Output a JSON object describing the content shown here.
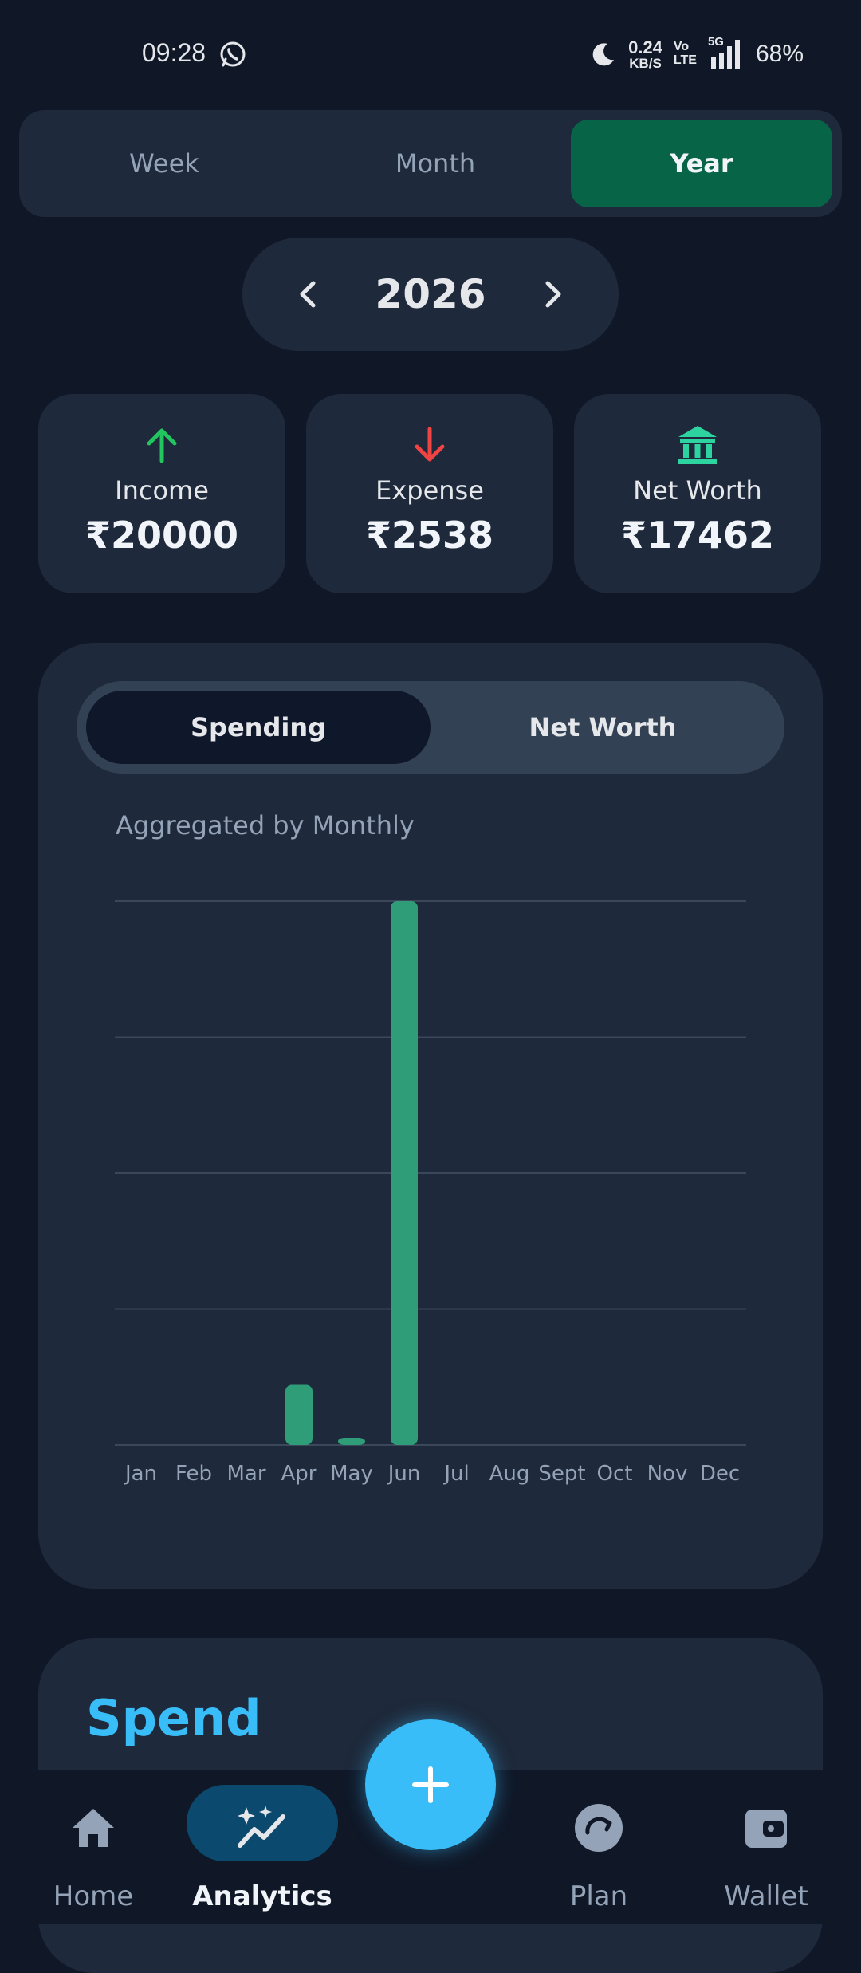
{
  "status_bar": {
    "time": "09:28",
    "net_speed_value": "0.24",
    "net_speed_unit": "KB/S",
    "volte_top": "Vo",
    "volte_bottom": "LTE",
    "network": "5G",
    "battery": "68%"
  },
  "period_tabs": [
    "Week",
    "Month",
    "Year"
  ],
  "active_period": "Year",
  "year_nav": {
    "year": "2026"
  },
  "stats": {
    "income": {
      "label": "Income",
      "value": "₹20000"
    },
    "expense": {
      "label": "Expense",
      "value": "₹2538"
    },
    "net_worth": {
      "label": "Net Worth",
      "value": "₹17462"
    }
  },
  "chart_toggle": {
    "spending_label": "Spending",
    "net_worth_label": "Net Worth",
    "active": "Spending"
  },
  "chart_subtitle": "Aggregated by Monthly",
  "chart_data": {
    "type": "bar",
    "categories": [
      "Jan",
      "Feb",
      "Mar",
      "Apr",
      "May",
      "Jun",
      "Jul",
      "Aug",
      "Sept",
      "Oct",
      "Nov",
      "Dec"
    ],
    "values": [
      0,
      0,
      0,
      250,
      30,
      2258,
      0,
      0,
      0,
      0,
      0,
      0
    ],
    "ylim": [
      0,
      2258
    ],
    "grid": true,
    "bar_color": "#2f9e78"
  },
  "spend_section": {
    "title": "Spend"
  },
  "bottom_nav": {
    "home": "Home",
    "analytics": "Analytics",
    "plan": "Plan",
    "wallet": "Wallet",
    "active": "Analytics"
  },
  "colors": {
    "background": "#101828",
    "card": "#1e293b",
    "accent_green": "#076446",
    "accent_blue": "#38bdf8",
    "income_icon": "#22c55e",
    "expense_icon": "#ef4444",
    "net_worth_icon": "#2dd4a0"
  },
  "icons": {
    "income": "arrow-up-icon",
    "expense": "arrow-down-icon",
    "net_worth": "bank-icon",
    "home": "home-icon",
    "analytics": "sparkle-chart-icon",
    "fab": "plus-icon",
    "plan": "refresh-icon",
    "wallet": "wallet-icon"
  }
}
